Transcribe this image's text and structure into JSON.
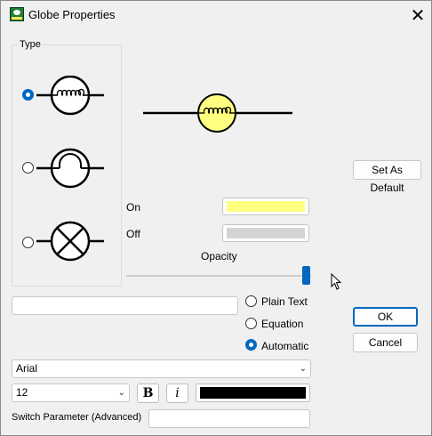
{
  "window": {
    "title": "Globe Properties"
  },
  "type_group": {
    "label": "Type",
    "options": [
      {
        "name": "coil-globe",
        "selected": true
      },
      {
        "name": "dome-globe",
        "selected": false
      },
      {
        "name": "cross-globe",
        "selected": false
      }
    ]
  },
  "buttons": {
    "set_default": "Set As Default",
    "ok": "OK",
    "cancel": "Cancel"
  },
  "colors": {
    "on_label": "On",
    "off_label": "Off",
    "on_color": "#ffff80",
    "off_color": "#d3d3d3",
    "opacity_label": "Opacity",
    "opacity_value": 1.0
  },
  "label_mode": {
    "options": [
      "Plain Text",
      "Equation",
      "Automatic"
    ],
    "selected": "Automatic",
    "text_value": ""
  },
  "font": {
    "family": "Arial",
    "size": "12",
    "bold_label": "B",
    "italic_label": "i",
    "text_color": "#000000"
  },
  "switch_param": {
    "label": "Switch Parameter (Advanced)",
    "value": ""
  }
}
